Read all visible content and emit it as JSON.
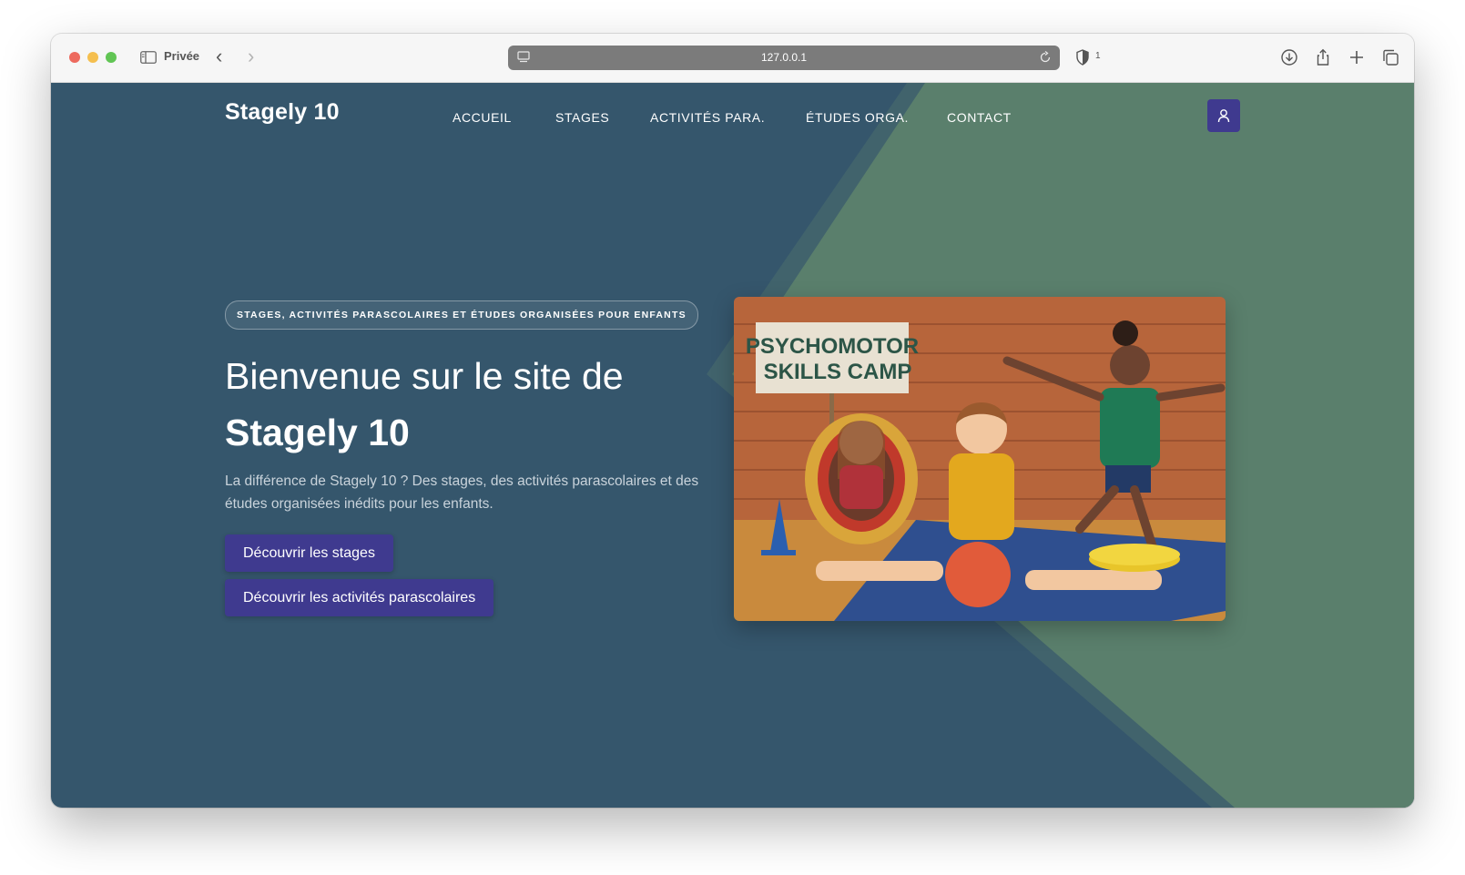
{
  "browser": {
    "private_label": "Privée",
    "url": "127.0.0.1",
    "shield_count": "1"
  },
  "site": {
    "brand": "Stagely 10",
    "nav": [
      "ACCUEIL",
      "STAGES",
      "ACTIVITÉS PARA.",
      "ÉTUDES ORGA.",
      "CONTACT"
    ]
  },
  "hero": {
    "tagline": "STAGES, ACTIVITÉS PARASCOLAIRES ET ÉTUDES ORGANISÉES POUR ENFANTS",
    "title_line1": "Bienvenue sur le site de",
    "title_line2": "Stagely 10",
    "description": "La différence de Stagely 10 ? Des stages, des activités parascolaires et des études organisées inédits pour les enfants.",
    "cta_stages": "Découvrir les stages",
    "cta_activities": "Découvrir les activités parascolaires",
    "image_sign_line1": "PSYCHOMOTOR",
    "image_sign_line2": "SKILLS CAMP"
  },
  "colors": {
    "page_bg": "#35566c",
    "accent_green": "#5a7f6c",
    "button": "#3f3a8f"
  }
}
